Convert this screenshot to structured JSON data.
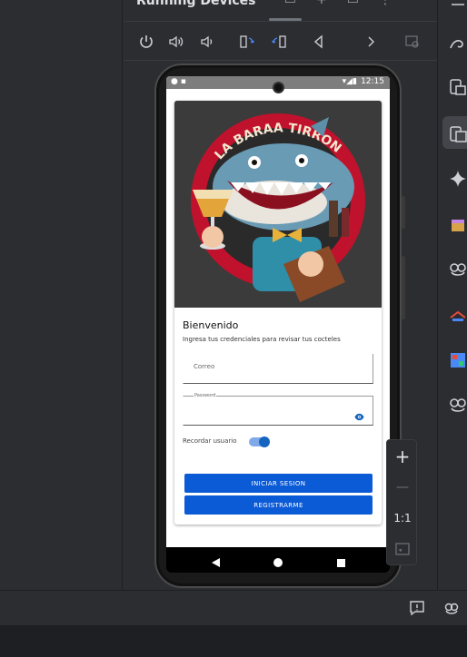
{
  "header": {
    "title": "Running Devices"
  },
  "toolbar": {
    "icons": [
      "power-icon",
      "volume-up-icon",
      "volume-down-icon",
      "rotate-left-icon",
      "rotate-right-icon",
      "back-icon",
      "forward-icon",
      "screenshot-icon"
    ]
  },
  "device": {
    "status_bar": {
      "time": "12:15"
    },
    "app": {
      "hero_text": "LA BARAA TIRRON",
      "title": "Bienvenido",
      "subtitle": "Ingresa tus credenciales para revisar tus cocteles",
      "email_placeholder": "Correo",
      "password_label": "Password",
      "remember_label": "Recordar usuario",
      "remember_on": true,
      "login_button": "INICIAR SESION",
      "register_button": "REGISTRARME"
    }
  },
  "zoom": {
    "plus": "+",
    "minus": "—",
    "one_to_one": "1:1"
  },
  "colors": {
    "accent": "#0b5ad6",
    "ide_background": "#2b2d30"
  }
}
